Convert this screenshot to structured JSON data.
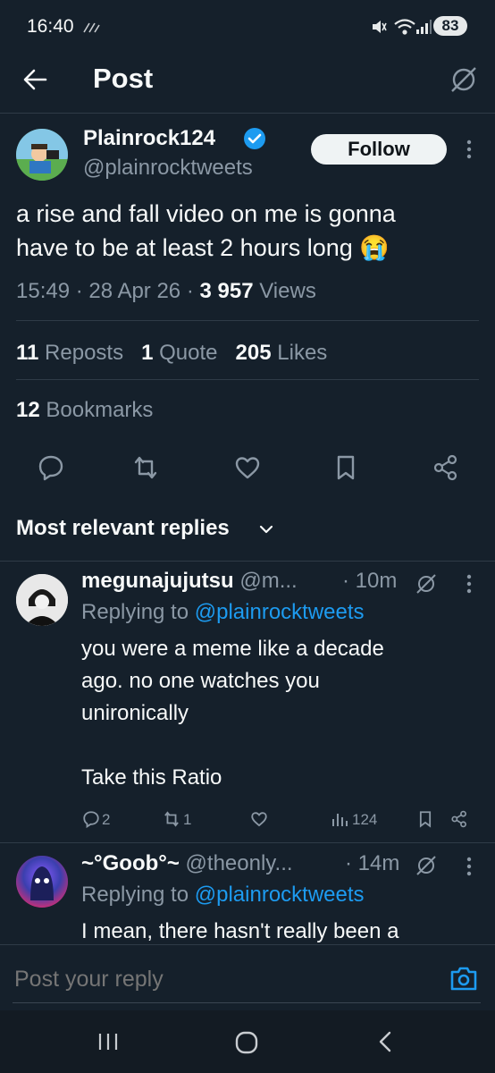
{
  "status": {
    "time": "16:40",
    "battery": "83",
    "colors": {
      "bg": "#15202b",
      "accent": "#1d9bf0",
      "muted": "#8b98a5"
    }
  },
  "header": {
    "title": "Post",
    "back_icon": "arrow-left-icon",
    "grok_icon": "slash-circle-icon"
  },
  "post": {
    "author_name": "Plainrock124",
    "handle": "@plainrocktweets",
    "follow_label": "Follow",
    "text_line1": "a rise and fall video on me is gonna",
    "text_line2": "have to be at least 2 hours long",
    "emoji": "😭",
    "time": "15:49",
    "date": "28 Apr 26",
    "views_count": "3 957",
    "views_label": "Views",
    "reposts_count": "11",
    "reposts_label": "Reposts",
    "quotes_count": "1",
    "quotes_label": "Quote",
    "likes_count": "205",
    "likes_label": "Likes",
    "bookmarks_count": "12",
    "bookmarks_label": "Bookmarks",
    "dot": "·"
  },
  "replies_header": {
    "label": "Most relevant replies"
  },
  "replies": [
    {
      "name": "megunajujutsu",
      "handle": "@m...",
      "time": "· 10m",
      "replying_prefix": "Replying to",
      "replying_to": "@plainrocktweets",
      "lines": [
        "you were a meme like a decade",
        "ago. no one watches you",
        "unironically",
        "Take this Ratio"
      ],
      "reply_count": "2",
      "repost_count": "1",
      "like_count": "",
      "views_count": "124"
    },
    {
      "name": "~°Goob°~",
      "handle": "@theonly...",
      "time": "· 14m",
      "replying_prefix": "Replying to",
      "replying_to": "@plainrocktweets",
      "lines": [
        "I mean, there hasn't really been a"
      ]
    }
  ],
  "composer": {
    "placeholder": "Post your reply"
  }
}
